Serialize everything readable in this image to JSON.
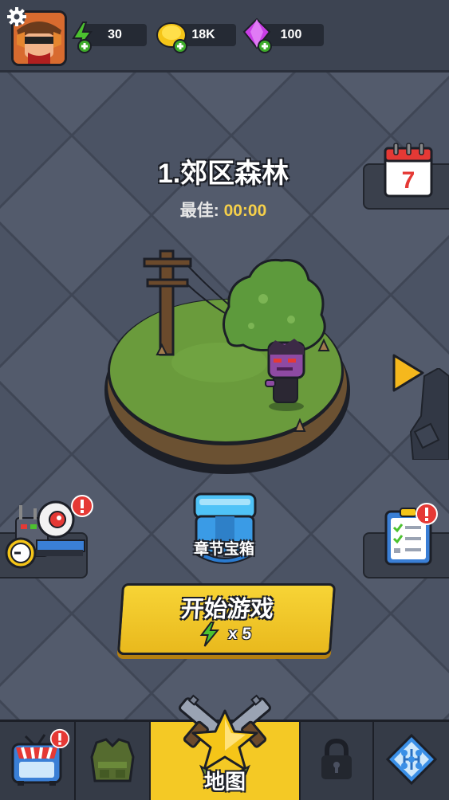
{
  "resources": {
    "energy": "30",
    "coins": "18K",
    "gems": "100"
  },
  "level": {
    "title": "1.郊区森林",
    "best_label": "最佳:",
    "best_time": "00:00"
  },
  "chest": {
    "label": "章节宝箱"
  },
  "start": {
    "label": "开始游戏",
    "cost": "x 5"
  },
  "calendar": {
    "day": "7"
  },
  "nav": {
    "map_label": "地图"
  },
  "colors": {
    "accent_yellow": "#f4c925",
    "alert_red": "#e53935",
    "energy_green": "#4cc22f",
    "gem_purple": "#c93ee6",
    "coin_gold": "#f5c518"
  }
}
